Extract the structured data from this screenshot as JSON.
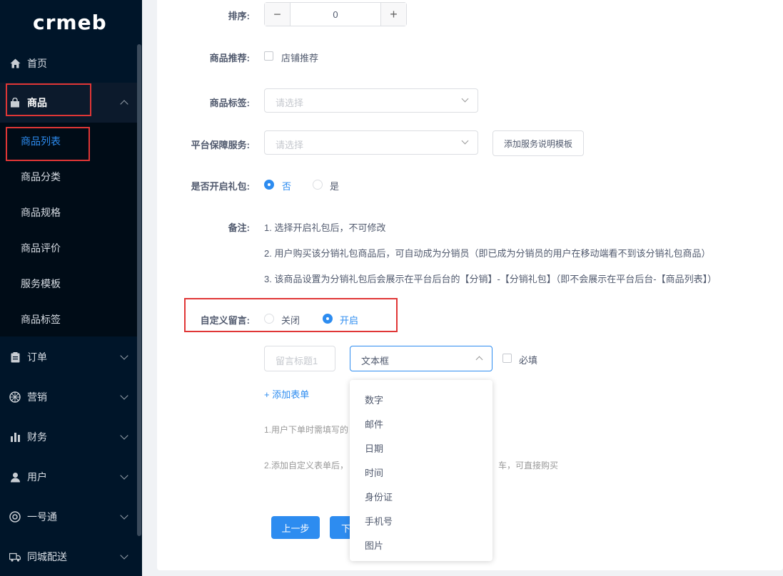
{
  "logo": {
    "text": "crmeb"
  },
  "sidebar": {
    "items": [
      {
        "label": "首页",
        "icon": "home-icon"
      },
      {
        "label": "商品",
        "icon": "bag-icon"
      },
      {
        "label": "订单",
        "icon": "clipboard-icon"
      },
      {
        "label": "营销",
        "icon": "aperture-icon"
      },
      {
        "label": "财务",
        "icon": "bar-chart-icon"
      },
      {
        "label": "用户",
        "icon": "user-icon"
      },
      {
        "label": "一号通",
        "icon": "lifebuoy-icon"
      },
      {
        "label": "同城配送",
        "icon": "truck-icon"
      }
    ],
    "submenu": [
      {
        "label": "商品列表"
      },
      {
        "label": "商品分类"
      },
      {
        "label": "商品规格"
      },
      {
        "label": "商品评价"
      },
      {
        "label": "服务模板"
      },
      {
        "label": "商品标签"
      }
    ]
  },
  "form": {
    "sort": {
      "label": "排序:",
      "value": "0",
      "minus": "−",
      "plus": "+"
    },
    "recommend": {
      "label": "商品推荐:",
      "option": "店铺推荐"
    },
    "tags": {
      "label": "商品标签:",
      "placeholder": "请选择"
    },
    "service": {
      "label": "平台保障服务:",
      "placeholder": "请选择",
      "button": "添加服务说明模板"
    },
    "gift": {
      "label": "是否开启礼包:",
      "options": [
        "否",
        "是"
      ],
      "selected": "否"
    },
    "remark": {
      "label": "备注:",
      "lines": [
        "1. 选择开启礼包后，不可修改",
        "2. 用户购买该分销礼包商品后，可自动成为分销员（即已成为分销员的用户在移动端看不到该分销礼包商品）",
        "3. 该商品设置为分销礼包后会展示在平台后台的【分销】-【分销礼包】（即不会展示在平台后台-【商品列表】）"
      ]
    },
    "custom_message": {
      "label": "自定义留言:",
      "options": [
        "关闭",
        "开启"
      ],
      "selected": "开启",
      "title_placeholder": "留言标题1",
      "type_value": "文本框",
      "required_label": "必填",
      "add_link": "+ 添加表单",
      "tip1": "1.用户下单时需填写的",
      "tip2a": "2.添加自定义表单后，",
      "tip2b": "车，可直接购买"
    },
    "type_options": [
      "数字",
      "邮件",
      "日期",
      "时间",
      "身份证",
      "手机号",
      "图片"
    ]
  },
  "footer": {
    "prev": "上一步",
    "next": "下"
  },
  "colors": {
    "primary": "#2d8cf0",
    "sidebar_bg": "#001529",
    "highlight": "#e03636"
  }
}
